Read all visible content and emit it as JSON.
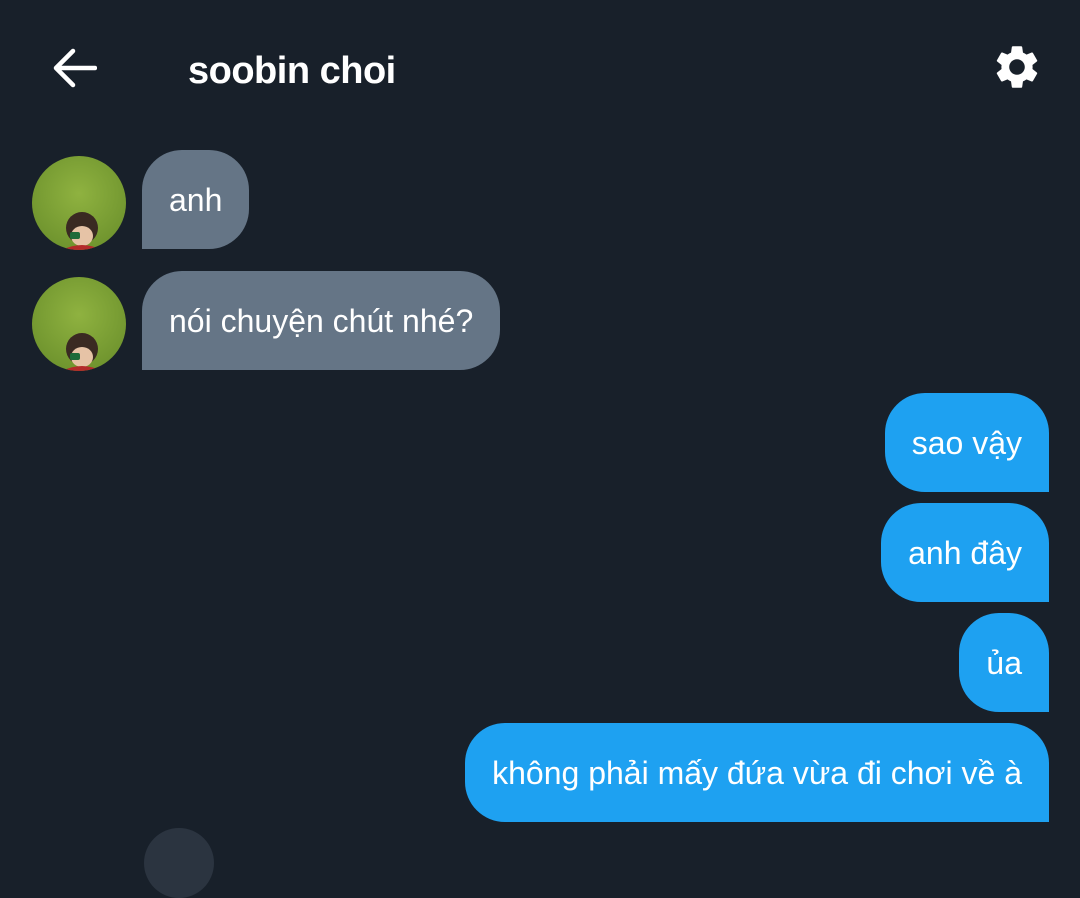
{
  "header": {
    "title": "soobin choi",
    "back_icon": "arrow-left-icon",
    "settings_icon": "gear-icon"
  },
  "messages": [
    {
      "direction": "incoming",
      "text": "anh"
    },
    {
      "direction": "incoming",
      "text": "nói chuyện chút nhé?"
    },
    {
      "direction": "outgoing",
      "text": "sao vậy"
    },
    {
      "direction": "outgoing",
      "text": "anh đây"
    },
    {
      "direction": "outgoing",
      "text": "ủa"
    },
    {
      "direction": "outgoing",
      "text": "không phải mấy đứa vừa đi chơi về à"
    }
  ],
  "colors": {
    "background": "#18202a",
    "incoming_bubble": "#657586",
    "outgoing_bubble": "#1ea1f1",
    "text": "#ffffff"
  }
}
